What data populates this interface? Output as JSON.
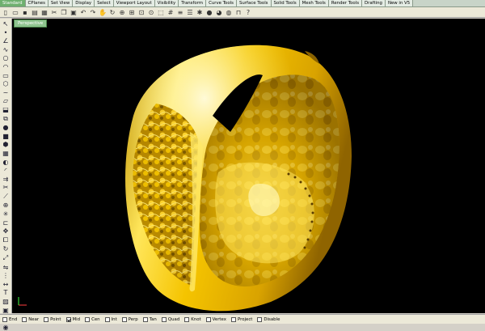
{
  "tabs": [
    "Standard",
    "CPlanes",
    "Set View",
    "Display",
    "Select",
    "Viewport Layout",
    "Visibility",
    "Transform",
    "Curve Tools",
    "Surface Tools",
    "Solid Tools",
    "Mesh Tools",
    "Render Tools",
    "Drafting",
    "New in V5"
  ],
  "active_tab_index": 0,
  "toolbar_icons": [
    "new-file-icon",
    "open-file-icon",
    "save-icon",
    "print-icon",
    "import-icon",
    "cut-icon",
    "copy-icon",
    "paste-icon",
    "undo-icon",
    "redo-icon",
    "pan-icon",
    "rotate-view-icon",
    "zoom-icon",
    "zoom-window-icon",
    "zoom-extents-icon",
    "zoom-selected-icon",
    "select-icon",
    "grid-icon",
    "layer-icon",
    "properties-icon",
    "lightbulb-icon",
    "render-sphere-icon",
    "color-wheel-icon",
    "material-icon",
    "lock-icon",
    "help-icon"
  ],
  "sidebar_icons": [
    "pointer-icon",
    "point-icon",
    "polyline-icon",
    "curve-icon",
    "circle-icon",
    "arc-icon",
    "rectangle-icon",
    "polygon-icon",
    "free-curve-icon",
    "surface-icon",
    "extrude-icon",
    "loft-icon",
    "sphere-icon",
    "box-icon",
    "solid-icon",
    "mesh-icon",
    "boolean-icon",
    "fillet-icon",
    "offset-icon",
    "trim-icon",
    "split-icon",
    "join-icon",
    "explode-icon",
    "group-icon",
    "move-icon",
    "copy-obj-icon",
    "rotate-icon",
    "scale-icon",
    "mirror-icon",
    "array-icon",
    "dimension-icon",
    "text-icon",
    "hatch-icon",
    "block-icon",
    "analyze-icon",
    "render-icon"
  ],
  "viewport": {
    "name": "Perspective"
  },
  "axis": {
    "x_label": "x",
    "y_label": "y"
  },
  "osnaps": [
    {
      "label": "End",
      "checked": false
    },
    {
      "label": "Near",
      "checked": false
    },
    {
      "label": "Point",
      "checked": false
    },
    {
      "label": "Mid",
      "checked": true
    },
    {
      "label": "Cen",
      "checked": false
    },
    {
      "label": "Int",
      "checked": false
    },
    {
      "label": "Perp",
      "checked": false
    },
    {
      "label": "Tan",
      "checked": false
    },
    {
      "label": "Quad",
      "checked": false
    },
    {
      "label": "Knot",
      "checked": false
    },
    {
      "label": "Vertex",
      "checked": false
    },
    {
      "label": "Project",
      "checked": false
    },
    {
      "label": "Disable",
      "checked": false
    }
  ],
  "colors": {
    "gold_light": "#fff27a",
    "gold_mid": "#e8b800",
    "gold_dark": "#6b4a00",
    "viewport_bg": "#000000",
    "active_tab": "#6fb06f"
  }
}
